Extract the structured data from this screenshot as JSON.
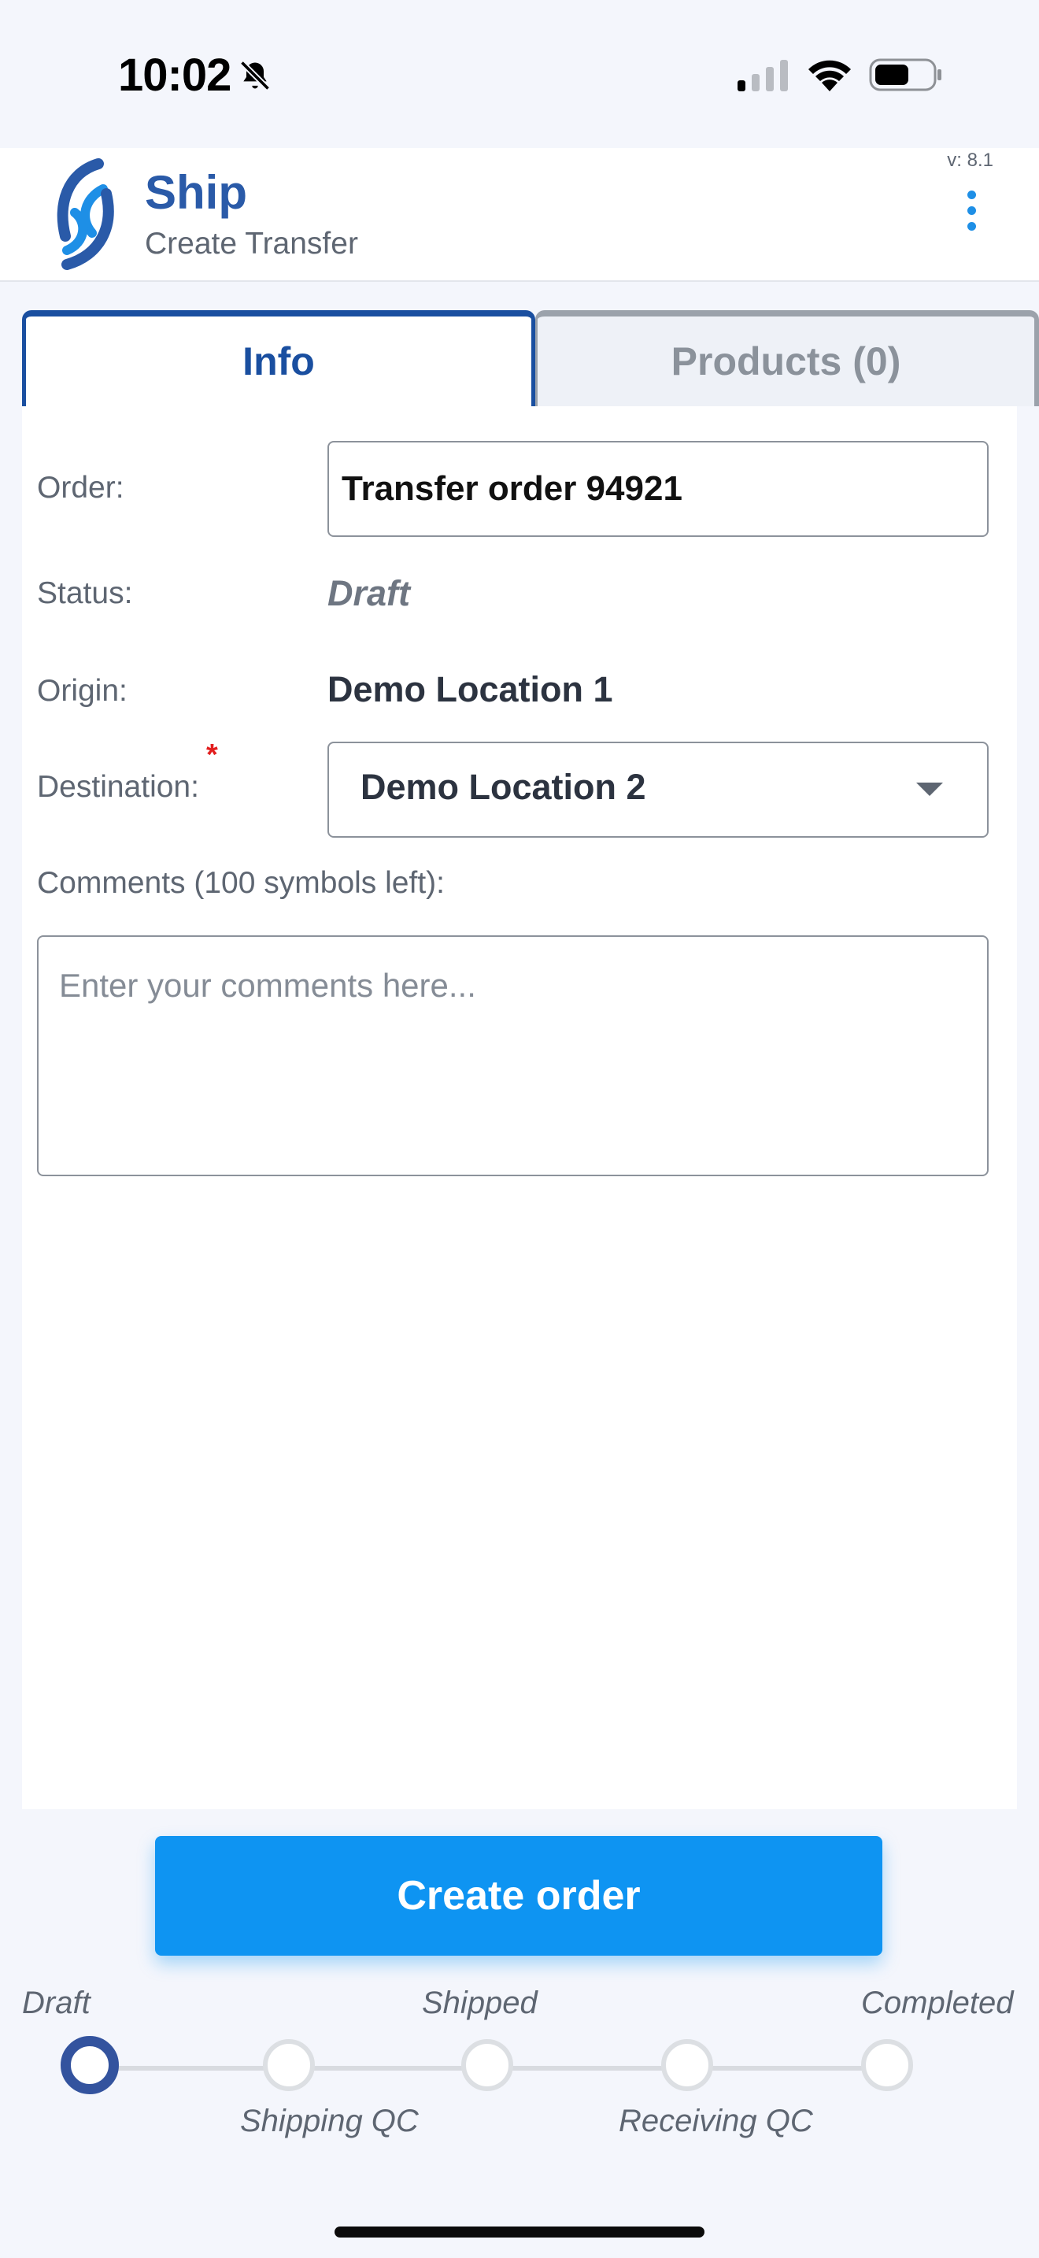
{
  "status_bar": {
    "time": "10:02"
  },
  "header": {
    "title": "Ship",
    "subtitle": "Create Transfer",
    "version": "v: 8.1"
  },
  "tabs": [
    {
      "label": "Info",
      "active": true
    },
    {
      "label": "Products (0)",
      "active": false
    }
  ],
  "form": {
    "order_label": "Order:",
    "order_value": "Transfer order 94921",
    "status_label": "Status:",
    "status_value": "Draft",
    "origin_label": "Origin:",
    "origin_value": "Demo Location 1",
    "destination_label": "Destination:",
    "destination_required": "*",
    "destination_value": "Demo Location 2",
    "comments_label": "Comments (100 symbols left):",
    "comments_placeholder": "Enter your comments here..."
  },
  "actions": {
    "create_label": "Create order"
  },
  "progress": {
    "current_step": "Draft",
    "steps": [
      "Draft",
      "Shipping QC",
      "Shipped",
      "Receiving QC",
      "Completed"
    ]
  },
  "colors": {
    "brand": "#2a5aa8",
    "tab_active": "#1a4fa0",
    "primary_button": "#0e94f2",
    "required": "#e21e1e"
  }
}
